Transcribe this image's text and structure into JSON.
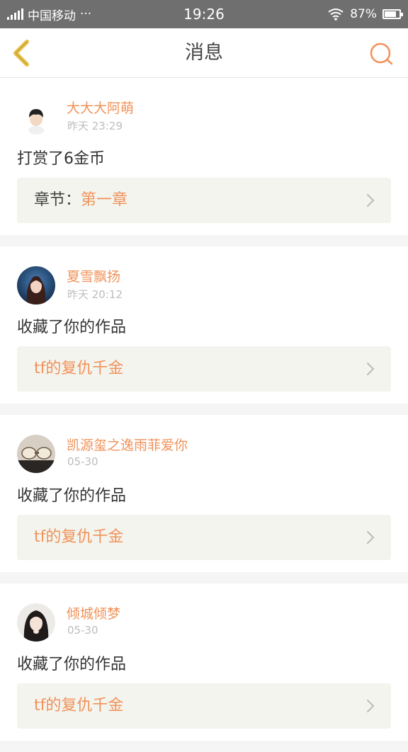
{
  "status_bar": {
    "carrier": "中国移动",
    "dots": "···",
    "time": "19:26",
    "battery": "87%",
    "battery_level": 0.87
  },
  "header": {
    "title": "消息",
    "back_icon": "chevron-left-icon",
    "search_icon": "search-icon"
  },
  "colors": {
    "accent": "#f0925a",
    "back_icon": "#e8c04a",
    "card_bg": "#f4f4ee"
  },
  "messages": [
    {
      "username": "大大大阿萌",
      "time": "昨天 23:29",
      "action": "打赏了6金币",
      "detail_label": "章节：",
      "detail_link": "第一章"
    },
    {
      "username": "夏雪飘扬",
      "time": "昨天 20:12",
      "action": "收藏了你的作品",
      "detail_label": "",
      "detail_link": "tf的复仇千金"
    },
    {
      "username": "凯源玺之逸雨菲爱你",
      "time": "05-30",
      "action": "收藏了你的作品",
      "detail_label": "",
      "detail_link": "tf的复仇千金"
    },
    {
      "username": "倾城倾梦",
      "time": "05-30",
      "action": "收藏了你的作品",
      "detail_label": "",
      "detail_link": "tf的复仇千金"
    }
  ]
}
